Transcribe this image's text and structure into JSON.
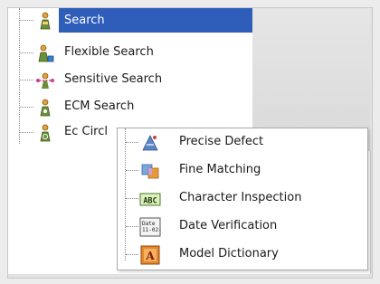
{
  "tree": {
    "items": [
      {
        "label": "Search",
        "icon": "person-search-icon",
        "selected": true
      },
      {
        "label": "Flexible Search",
        "icon": "flexible-search-icon"
      },
      {
        "label": "Sensitive Search",
        "icon": "sensitive-search-icon"
      },
      {
        "label": "ECM Search",
        "icon": "ecm-search-icon"
      },
      {
        "label": "Ec Circl",
        "icon": "ec-circle-icon"
      }
    ]
  },
  "popup": {
    "items": [
      {
        "label": "Precise Defect",
        "icon": "precise-defect-icon"
      },
      {
        "label": "Fine Matching",
        "icon": "fine-matching-icon"
      },
      {
        "label": "Character Inspection",
        "icon": "character-inspection-icon",
        "icon_text": "ABC"
      },
      {
        "label": "Date Verification",
        "icon": "date-verification-icon",
        "icon_text": "Date 11-02-1"
      },
      {
        "label": "Model Dictionary",
        "icon": "model-dictionary-icon",
        "icon_text": "A"
      }
    ]
  },
  "colors": {
    "selection": "#2f5dba",
    "selection_text": "#ffffff"
  }
}
